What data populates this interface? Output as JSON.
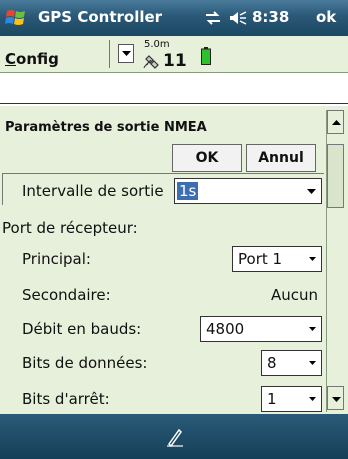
{
  "titlebar": {
    "app_title": "GPS Controller",
    "time": "8:38",
    "ok_label": "ok",
    "icons": [
      "windows-logo-icon",
      "sync-icon",
      "volume-icon"
    ]
  },
  "toolbar": {
    "config_menu_first": "C",
    "config_menu_rest": "onfig",
    "accuracy": "5.0m",
    "satellite_count": "11",
    "icons": [
      "dropdown-arrow-icon",
      "satellite-icon",
      "battery-icon"
    ]
  },
  "dialog": {
    "title": "Paramètres de sortie NMEA",
    "ok_button": "OK",
    "cancel_button": "Annul",
    "interval": {
      "label": "Intervalle de sortie",
      "value": "1s"
    },
    "receiver_port_heading": "Port de récepteur:",
    "primary": {
      "label": "Principal:",
      "value": "Port 1"
    },
    "secondary": {
      "label": "Secondaire:",
      "value": "Aucun"
    },
    "baud": {
      "label": "Débit en bauds:",
      "value": "4800"
    },
    "data_bits": {
      "label": "Bits de données:",
      "value": "8"
    },
    "stop_bits": {
      "label": "Bits d'arrêt:",
      "value": "1"
    }
  },
  "colors": {
    "title_bar": "#2a5876",
    "panel_bg": "#e6f0da",
    "selection": "#3d6fb0"
  }
}
